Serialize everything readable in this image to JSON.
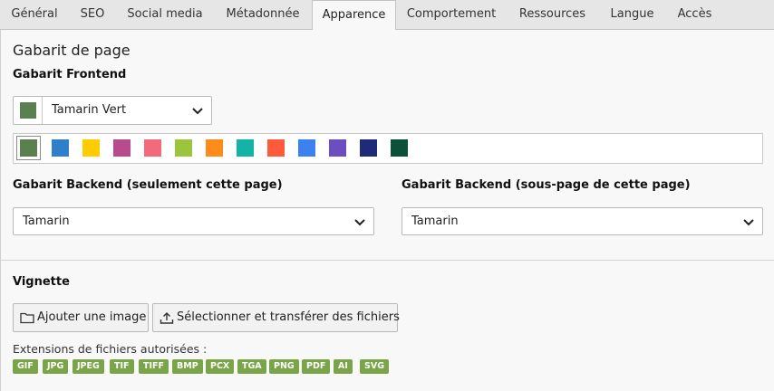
{
  "tabs": [
    {
      "label": "Général"
    },
    {
      "label": "SEO"
    },
    {
      "label": "Social media"
    },
    {
      "label": "Métadonnée"
    },
    {
      "label": "Apparence",
      "active": true
    },
    {
      "label": "Comportement"
    },
    {
      "label": "Ressources"
    },
    {
      "label": "Langue"
    },
    {
      "label": "Accès"
    }
  ],
  "layout_section": {
    "title": "Gabarit de page",
    "frontend": {
      "label": "Gabarit Frontend",
      "selected": "Tamarin Vert",
      "selected_color": "#5b8050",
      "palette": [
        "#5b8050",
        "#2f7fca",
        "#ffcc00",
        "#b84b8c",
        "#f36b7b",
        "#9bc53d",
        "#ff8c1a",
        "#13b3a5",
        "#ff5a3c",
        "#3b82f0",
        "#6b4fc0",
        "#1f2a78",
        "#0b5038"
      ]
    },
    "backend": {
      "label": "Gabarit Backend (seulement cette page)",
      "selected": "Tamarin"
    },
    "backend_sub": {
      "label": "Gabarit Backend (sous-page de cette page)",
      "selected": "Tamarin"
    }
  },
  "thumbnail": {
    "label": "Vignette",
    "add_image_button": "Ajouter une image",
    "upload_button": "Sélectionner et transférer des fichiers",
    "extensions_label": "Extensions de fichiers autorisées :",
    "extensions": [
      "GIF",
      "JPG",
      "JPEG",
      "TIF",
      "TIFF",
      "BMP",
      "PCX",
      "TGA",
      "PNG",
      "PDF",
      "AI",
      "SVG"
    ],
    "badge_color": "#79a548"
  },
  "icons": {
    "dropdown": "chevron-down-icon",
    "add_image": "folder-icon",
    "upload": "upload-icon"
  }
}
